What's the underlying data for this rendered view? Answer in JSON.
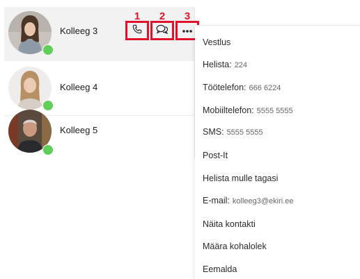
{
  "contacts": [
    {
      "name": "Kolleeg 3"
    },
    {
      "name": "Kolleeg 4"
    },
    {
      "name": "Kolleeg 5"
    }
  ],
  "annotations": [
    "1",
    "2",
    "3"
  ],
  "menu": {
    "items": [
      {
        "label": "Vestlus",
        "value": ""
      },
      {
        "label": "Helista:",
        "value": "224"
      },
      {
        "label": "Töötelefon:",
        "value": "666 6224"
      },
      {
        "label": "Mobiiltelefon:",
        "value": "5555 5555"
      },
      {
        "label": "SMS:",
        "value": "5555 5555"
      },
      {
        "label": "Post-It",
        "value": ""
      },
      {
        "label": "Helista mulle tagasi",
        "value": ""
      },
      {
        "label": "E-mail:",
        "value": "kolleeg3@ekiri.ee"
      },
      {
        "label": "Näita kontakti",
        "value": ""
      },
      {
        "label": "Määra kohalolek",
        "value": ""
      },
      {
        "label": "Eemalda",
        "value": ""
      }
    ]
  },
  "colors": {
    "annotation": "#e0112b",
    "online": "#5fcf5a",
    "selected_row": "#f2f2f2"
  },
  "icons": [
    "phone-icon",
    "chat-icon",
    "more-icon"
  ]
}
